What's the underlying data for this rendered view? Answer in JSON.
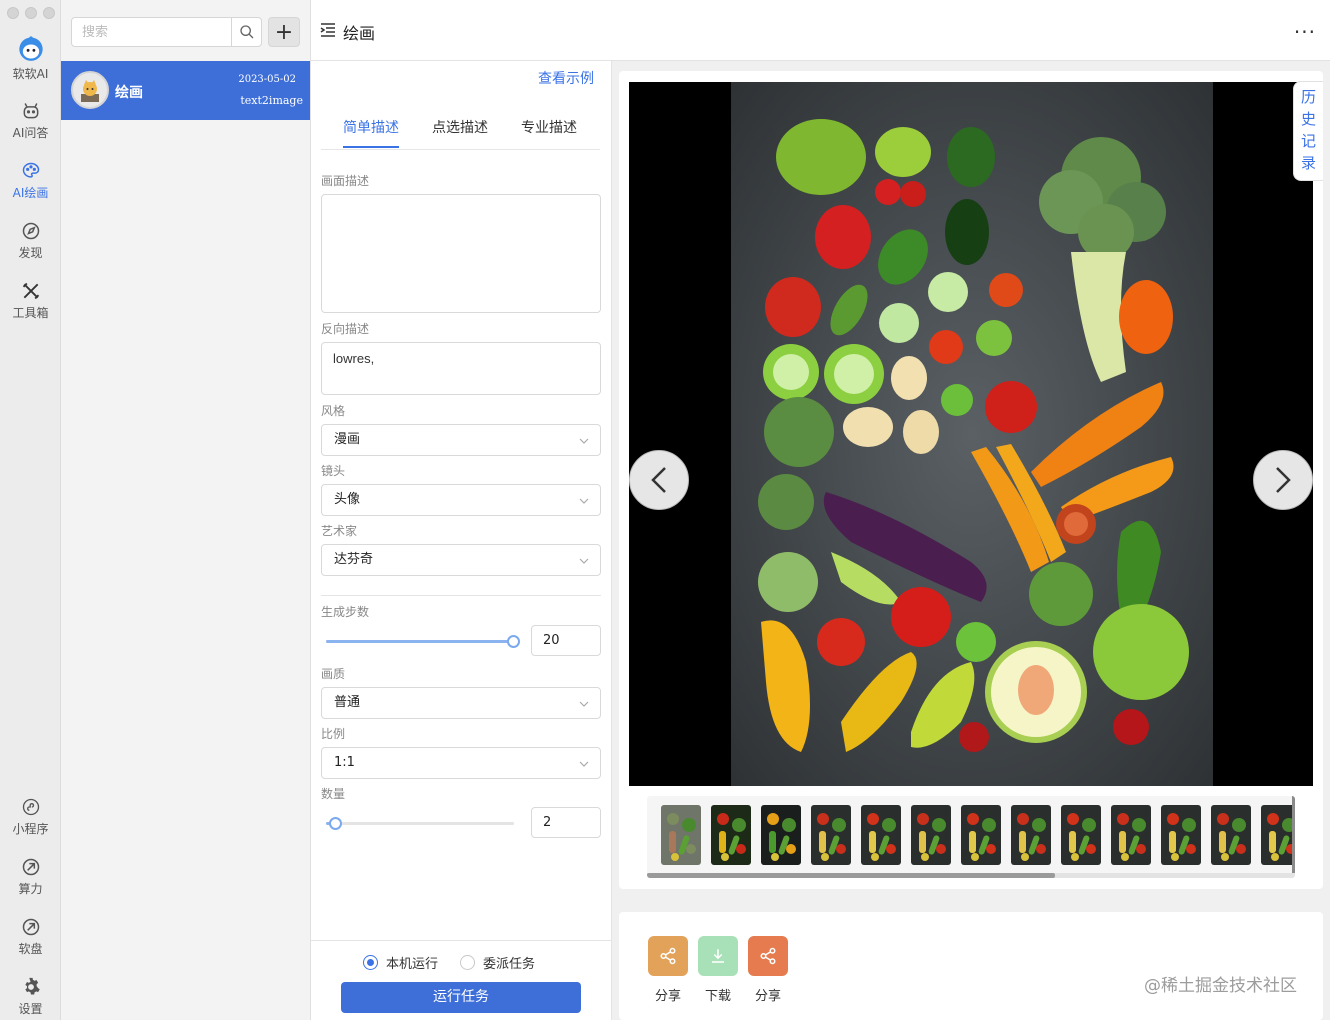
{
  "window": {
    "title": "绘画"
  },
  "rail": {
    "items": [
      {
        "label": "软软AI",
        "icon": "robot-avatar-icon"
      },
      {
        "label": "AI问答",
        "icon": "chat-bot-icon"
      },
      {
        "label": "AI绘画",
        "icon": "palette-icon"
      },
      {
        "label": "发现",
        "icon": "compass-icon"
      },
      {
        "label": "工具箱",
        "icon": "tools-icon"
      }
    ],
    "bottom_items": [
      {
        "label": "小程序",
        "icon": "miniapp-icon"
      },
      {
        "label": "算力",
        "icon": "compute-icon"
      },
      {
        "label": "软盘",
        "icon": "disk-icon"
      },
      {
        "label": "设置",
        "icon": "gear-icon"
      }
    ],
    "active_color": "#3b73e6"
  },
  "sidebar": {
    "search": {
      "placeholder": "搜索"
    },
    "add_label": "+",
    "conversations": [
      {
        "title": "绘画",
        "date": "2023-05-02",
        "subtitle": "text2image"
      }
    ]
  },
  "header": {
    "title": "绘画",
    "more": "···"
  },
  "form": {
    "example_link": "查看示例",
    "tabs": [
      {
        "label": "简单描述",
        "active": true
      },
      {
        "label": "点选描述",
        "active": false
      },
      {
        "label": "专业描述",
        "active": false
      }
    ],
    "prompt": {
      "label": "画面描述",
      "value": ""
    },
    "negative": {
      "label": "反向描述",
      "value": "lowres,"
    },
    "style": {
      "label": "风格",
      "value": "漫画"
    },
    "lens": {
      "label": "镜头",
      "value": "头像"
    },
    "artist": {
      "label": "艺术家",
      "value": "达芬奇"
    },
    "steps": {
      "label": "生成步数",
      "value": "20",
      "fraction": 1.0
    },
    "quality": {
      "label": "画质",
      "value": "普通"
    },
    "ratio": {
      "label": "比例",
      "value": "1:1"
    },
    "count": {
      "label": "数量",
      "value": "2",
      "fraction": 0.05
    },
    "run_mode": [
      {
        "label": "本机运行",
        "checked": true
      },
      {
        "label": "委派任务",
        "checked": false
      }
    ],
    "run_button": "运行任务"
  },
  "viewer": {
    "history_label": "历史记录",
    "thumbnail_count": 13
  },
  "actions": [
    {
      "label": "分享",
      "color": "#e3a25a",
      "icon": "share-icon"
    },
    {
      "label": "下载",
      "color": "#a8e0b8",
      "icon": "download-icon"
    },
    {
      "label": "分享",
      "color": "#e57b4e",
      "icon": "share-icon"
    }
  ],
  "watermark": "@稀土掘金技术社区"
}
